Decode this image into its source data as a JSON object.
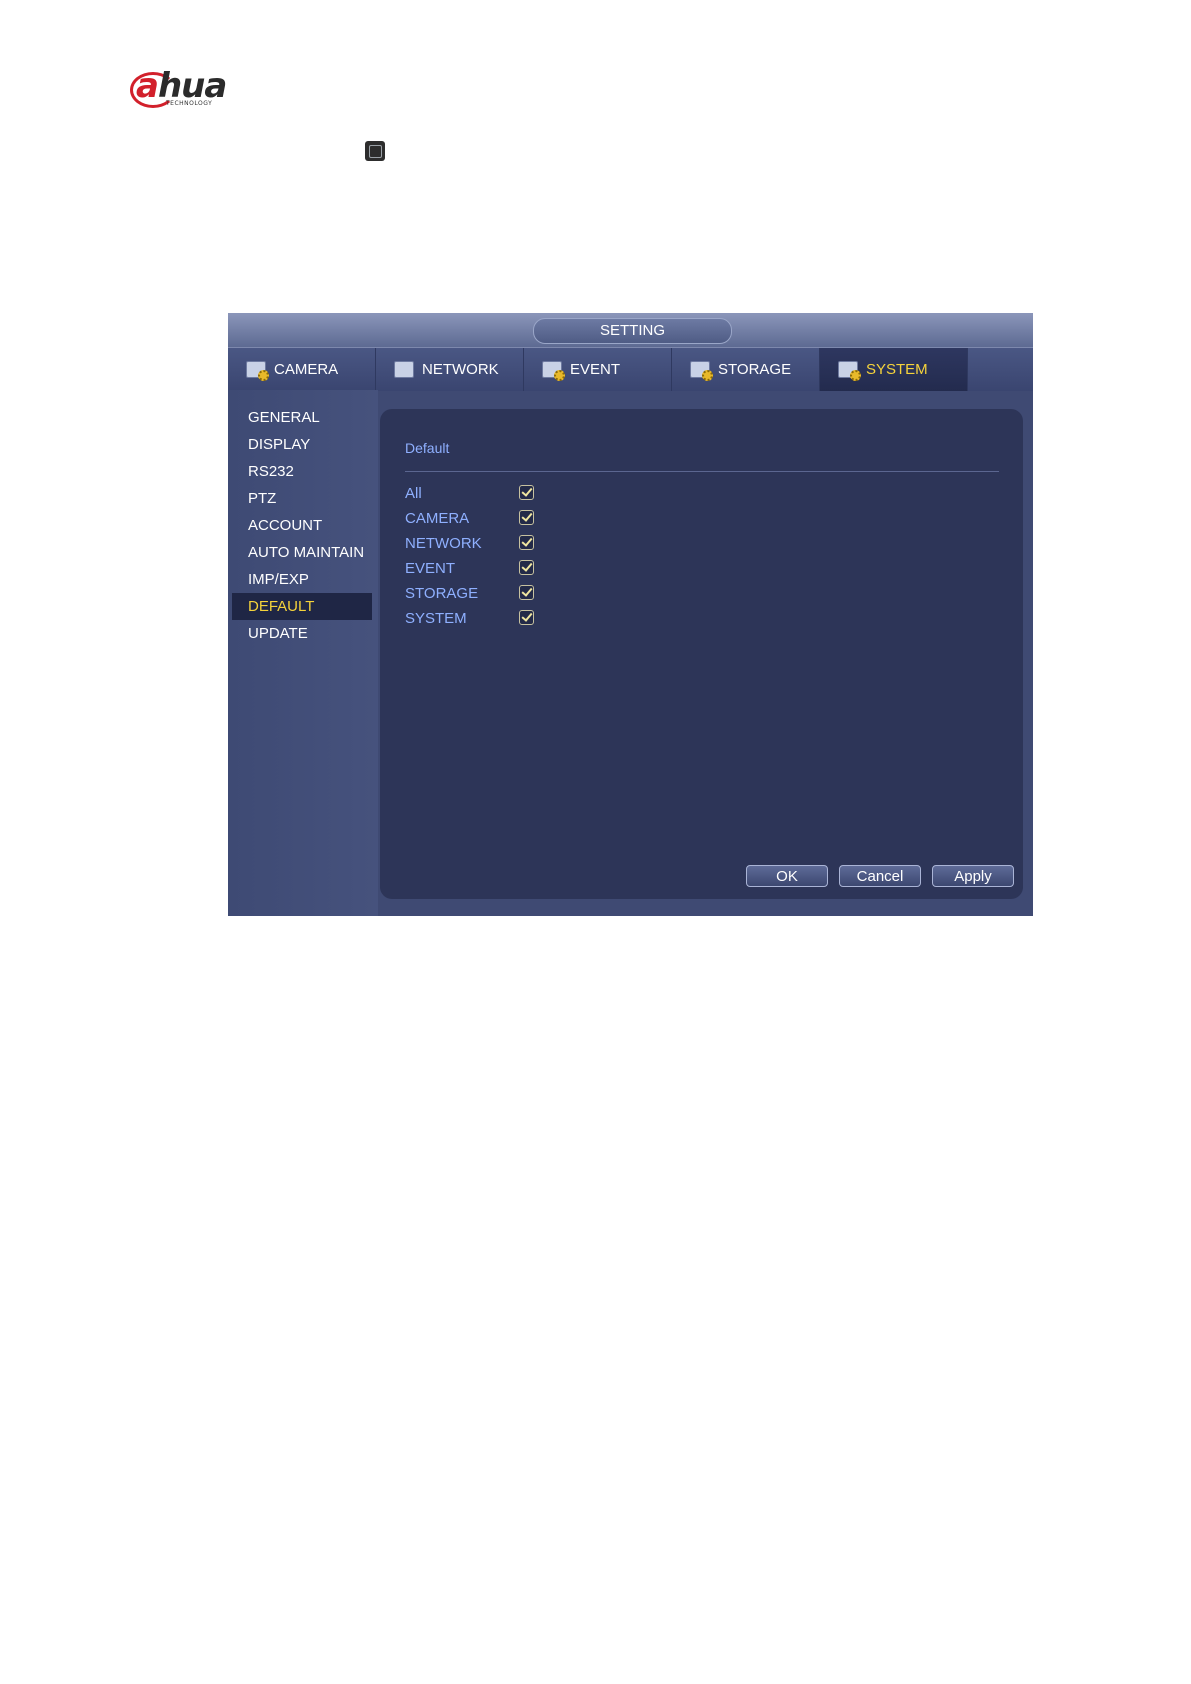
{
  "logo": {
    "main_prefix": "a",
    "main_rest": "hua",
    "sub": "TECHNOLOGY"
  },
  "window": {
    "title": "SETTING"
  },
  "tabs": [
    {
      "label": "CAMERA",
      "icon": "camera-settings-icon"
    },
    {
      "label": "NETWORK",
      "icon": "network-settings-icon"
    },
    {
      "label": "EVENT",
      "icon": "event-settings-icon"
    },
    {
      "label": "STORAGE",
      "icon": "storage-settings-icon"
    },
    {
      "label": "SYSTEM",
      "icon": "system-settings-icon",
      "active": true
    }
  ],
  "sidebar": {
    "items": [
      {
        "label": "GENERAL"
      },
      {
        "label": "DISPLAY"
      },
      {
        "label": "RS232"
      },
      {
        "label": "PTZ"
      },
      {
        "label": "ACCOUNT"
      },
      {
        "label": "AUTO MAINTAIN"
      },
      {
        "label": "IMP/EXP"
      },
      {
        "label": "DEFAULT",
        "active": true
      },
      {
        "label": "UPDATE"
      }
    ]
  },
  "panel": {
    "section_title": "Default",
    "options": [
      {
        "label": "All",
        "checked": true
      },
      {
        "label": "CAMERA",
        "checked": true
      },
      {
        "label": "NETWORK",
        "checked": true
      },
      {
        "label": "EVENT",
        "checked": true
      },
      {
        "label": "STORAGE",
        "checked": true
      },
      {
        "label": "SYSTEM",
        "checked": true
      }
    ]
  },
  "buttons": {
    "ok": "OK",
    "cancel": "Cancel",
    "apply": "Apply"
  },
  "colors": {
    "active_text": "#f5d33b",
    "option_text": "#8fb0ff",
    "logo_red": "#d2202b"
  }
}
